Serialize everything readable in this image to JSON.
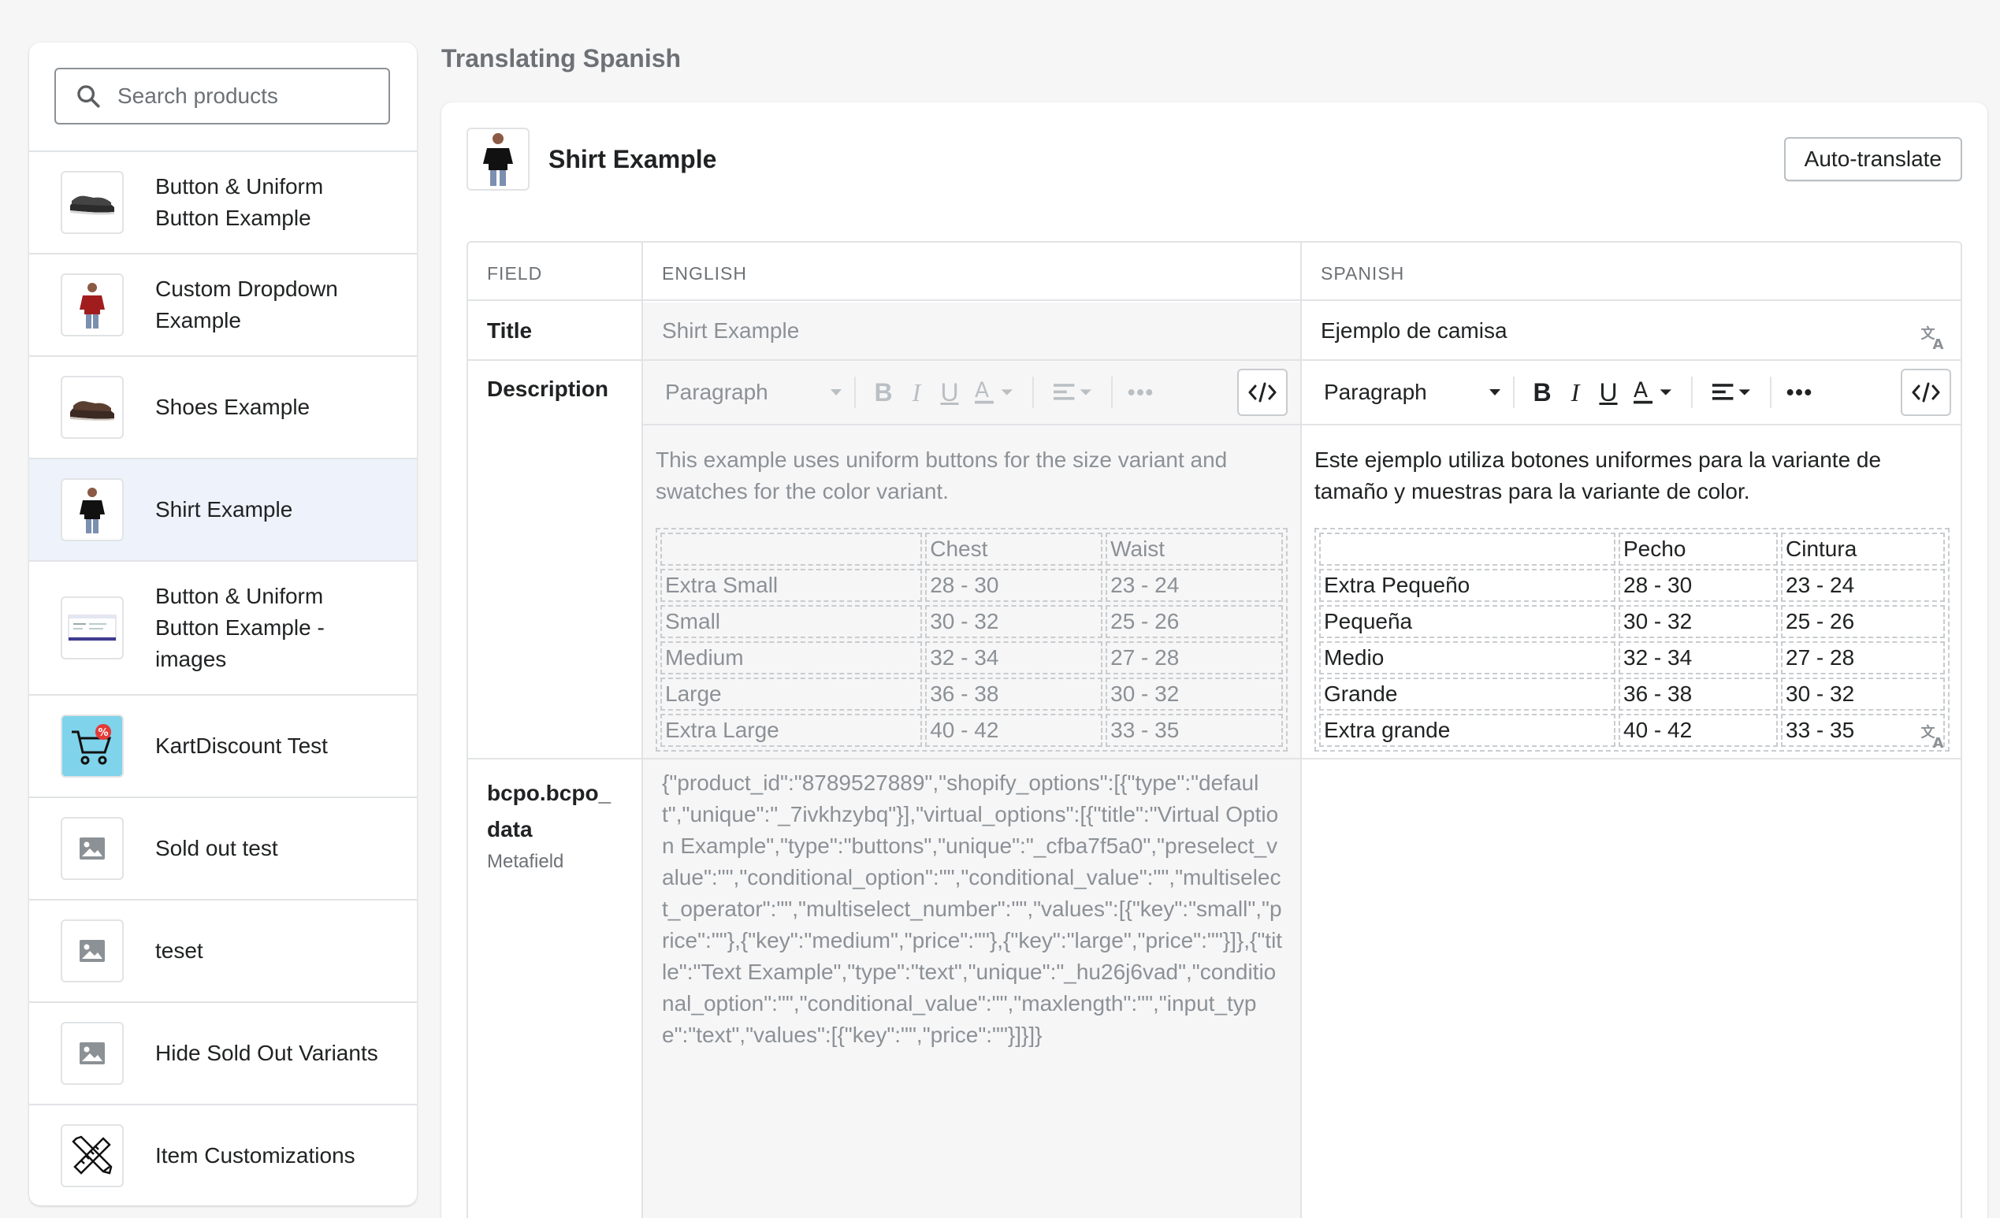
{
  "sidebar": {
    "search_placeholder": "Search products",
    "items": [
      {
        "label": "Button & Uniform Button Example",
        "thumb": "shoes-dark-icon"
      },
      {
        "label": "Custom Dropdown Example",
        "thumb": "red-shirt-model-icon"
      },
      {
        "label": "Shoes Example",
        "thumb": "shoes-brown-icon"
      },
      {
        "label": "Shirt Example",
        "thumb": "black-shirt-model-icon",
        "active": true
      },
      {
        "label": "Button & Uniform Button Example - images",
        "thumb": "screenshot-icon"
      },
      {
        "label": "KartDiscount Test",
        "thumb": "cart-discount-icon"
      },
      {
        "label": "Sold out test",
        "thumb": "image-placeholder-icon"
      },
      {
        "label": "teset",
        "thumb": "image-placeholder-icon"
      },
      {
        "label": "Hide Sold Out Variants",
        "thumb": "image-placeholder-icon"
      },
      {
        "label": "Item Customizations",
        "thumb": "pencil-ruler-icon"
      }
    ]
  },
  "main": {
    "heading": "Translating Spanish",
    "product_title": "Shirt Example",
    "auto_translate_label": "Auto-translate",
    "columns": {
      "field": "FIELD",
      "english": "ENGLISH",
      "spanish": "SPANISH"
    },
    "title_row": {
      "field": "Title",
      "english": "Shirt Example",
      "spanish": "Ejemplo de camisa"
    },
    "description_row": {
      "field": "Description",
      "toolbar_paragraph": "Paragraph",
      "english_text": "This example uses uniform buttons for the size variant  and swatches for the color variant.",
      "spanish_text": "Este ejemplo utiliza botones uniformes para la variante de tamaño y muestras para la variante de color.",
      "english_table": [
        [
          "",
          "Chest",
          "Waist"
        ],
        [
          "Extra Small",
          "28 - 30",
          "23 - 24"
        ],
        [
          "Small",
          "30 - 32",
          "25 - 26"
        ],
        [
          "Medium",
          "32 - 34",
          "27 - 28"
        ],
        [
          "Large",
          "36 - 38",
          "30 - 32"
        ],
        [
          "Extra Large",
          "40 - 42",
          "33 - 35"
        ]
      ],
      "spanish_table": [
        [
          "",
          "Pecho",
          "Cintura"
        ],
        [
          "Extra Pequeño",
          "28 - 30",
          "23 - 24"
        ],
        [
          "Pequeña",
          "30 - 32",
          "25 - 26"
        ],
        [
          "Medio",
          "32 - 34",
          "27 - 28"
        ],
        [
          "Grande",
          "36 - 38",
          "30 - 32"
        ],
        [
          "Extra grande",
          "40 - 42",
          "33 - 35"
        ]
      ]
    },
    "metafield_row": {
      "field_line1": "bcpo.bcpo_",
      "field_line2": "data",
      "field_sub": "Metafield",
      "english": "{\"product_id\":\"8789527889\",\"shopify_options\":[{\"type\":\"default\",\"unique\":\"_7ivkhzybq\"}],\"virtual_options\":[{\"title\":\"Virtual Option Example\",\"type\":\"buttons\",\"unique\":\"_cfba7f5a0\",\"preselect_value\":\"\",\"conditional_option\":\"\",\"conditional_value\":\"\",\"multiselect_operator\":\"\",\"multiselect_number\":\"\",\"values\":[{\"key\":\"small\",\"price\":\"\"},{\"key\":\"medium\",\"price\":\"\"},{\"key\":\"large\",\"price\":\"\"}]},{\"title\":\"Text Example\",\"type\":\"text\",\"unique\":\"_hu26j6vad\",\"conditional_option\":\"\",\"conditional_value\":\"\",\"maxlength\":\"\",\"input_type\":\"text\",\"values\":[{\"key\":\"\",\"price\":\"\"}]}]}"
    }
  }
}
